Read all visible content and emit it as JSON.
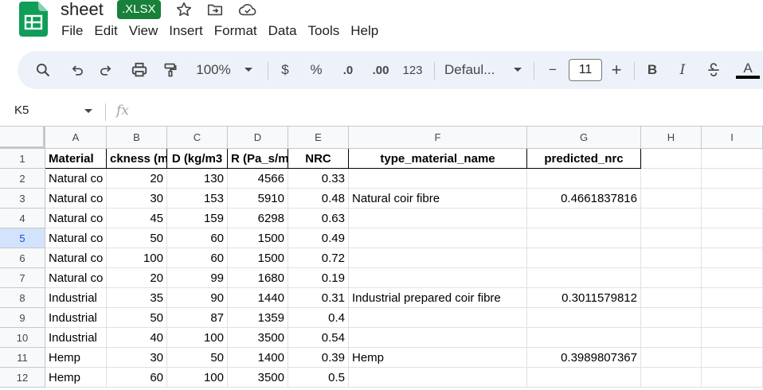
{
  "app": {
    "title": "sheet",
    "badge": ".XLSX",
    "brand_color": "#188038"
  },
  "menu": [
    "File",
    "Edit",
    "View",
    "Insert",
    "Format",
    "Data",
    "Tools",
    "Help"
  ],
  "toolbar": {
    "zoom": "100%",
    "currency": "$",
    "percent": "%",
    "decrease_decimal": ".0",
    "increase_decimal": ".00",
    "number_format": "123",
    "font": "Defaul...",
    "font_size": "11",
    "minus": "−",
    "plus": "+",
    "bold": "B",
    "italic": "I",
    "text_color": "A",
    "icons": [
      "search-icon",
      "undo-icon",
      "redo-icon",
      "print-icon",
      "paint-format-icon",
      "strikethrough-icon"
    ]
  },
  "formula_bar": {
    "cell_ref": "K5",
    "fx": "fx",
    "value": ""
  },
  "columns": [
    "A",
    "B",
    "C",
    "D",
    "E",
    "F",
    "G",
    "H",
    "I"
  ],
  "rows": [
    {
      "num": "1",
      "cells": [
        "Material",
        "ckness (m",
        "D (kg/m3",
        "R (Pa_s/m",
        "NRC",
        "type_material_name",
        "predicted_nrc",
        "",
        ""
      ]
    },
    {
      "num": "2",
      "cells": [
        "Natural co",
        "20",
        "130",
        "4566",
        "0.33",
        "",
        "",
        "",
        ""
      ]
    },
    {
      "num": "3",
      "cells": [
        "Natural co",
        "30",
        "153",
        "5910",
        "0.48",
        "Natural coir fibre",
        "0.4661837816",
        "",
        ""
      ]
    },
    {
      "num": "4",
      "cells": [
        "Natural co",
        "45",
        "159",
        "6298",
        "0.63",
        "",
        "",
        "",
        ""
      ]
    },
    {
      "num": "5",
      "cells": [
        "Natural co",
        "50",
        "60",
        "1500",
        "0.49",
        "",
        "",
        "",
        ""
      ]
    },
    {
      "num": "6",
      "cells": [
        "Natural co",
        "100",
        "60",
        "1500",
        "0.72",
        "",
        "",
        "",
        ""
      ]
    },
    {
      "num": "7",
      "cells": [
        "Natural co",
        "20",
        "99",
        "1680",
        "0.19",
        "",
        "",
        "",
        ""
      ]
    },
    {
      "num": "8",
      "cells": [
        "Industrial",
        "35",
        "90",
        "1440",
        "0.31",
        "Industrial prepared coir fibre",
        "0.3011579812",
        "",
        ""
      ]
    },
    {
      "num": "9",
      "cells": [
        "Industrial",
        "50",
        "87",
        "1359",
        "0.4",
        "",
        "",
        "",
        ""
      ]
    },
    {
      "num": "10",
      "cells": [
        "Industrial",
        "40",
        "100",
        "3500",
        "0.54",
        "",
        "",
        "",
        ""
      ]
    },
    {
      "num": "11",
      "cells": [
        "Hemp",
        "30",
        "50",
        "1400",
        "0.39",
        "Hemp",
        "0.3989807367",
        "",
        ""
      ]
    },
    {
      "num": "12",
      "cells": [
        "Hemp",
        "60",
        "100",
        "3500",
        "0.5",
        "",
        "",
        "",
        ""
      ]
    }
  ],
  "selected_row": "5"
}
